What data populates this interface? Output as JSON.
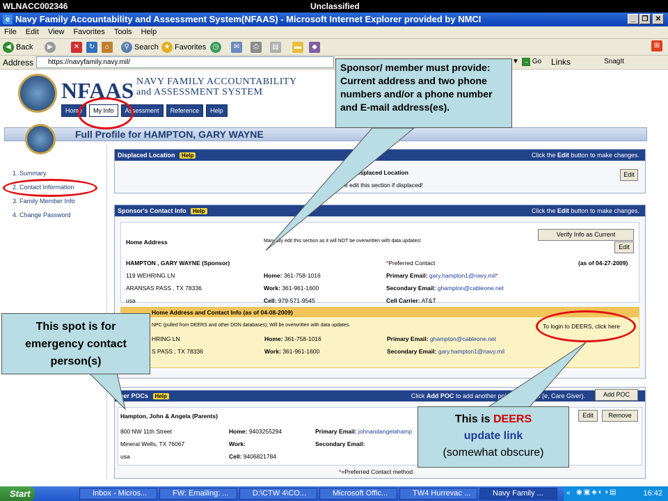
{
  "banner": {
    "left": "WLNACC002346",
    "center": "Unclassified"
  },
  "window": {
    "title": "Navy Family Accountability and Assessment System(NFAAS) - Microsoft Internet Explorer provided by NMCI"
  },
  "menu": [
    "File",
    "Edit",
    "View",
    "Favorites",
    "Tools",
    "Help"
  ],
  "toolbar": {
    "back": "Back",
    "search": "Search",
    "favorites": "Favorites"
  },
  "address": {
    "label": "Address",
    "url": "https://navyfamily.navy.mil/",
    "go": "Go",
    "links": "Links",
    "snagit": "SnagIt"
  },
  "site": {
    "brand": "NFAAS",
    "brand_sub_1": "NAVY FAMILY ACCOUNTABILITY",
    "brand_sub_2": "and ASSESSMENT SYSTEM",
    "tabs": [
      "Home",
      "My Info",
      "Assessment",
      "Reference",
      "Help"
    ],
    "profile_title": "Full Profile for HAMPTON, GARY WAYNE"
  },
  "leftnav": [
    "1. Summary",
    "2. Contact Information",
    "3. Family Member Info",
    "4. Change Password"
  ],
  "displaced": {
    "header": "Displaced Location",
    "help": "Help",
    "header_right_pre": "Click the ",
    "header_right_bold": "Edit",
    "header_right_post": " button to make changes.",
    "body_title": "Displaced Location",
    "body_note": "e edit this section if displaced!",
    "edit": "Edit"
  },
  "sponsor": {
    "header": "Sponsor's Contact Info",
    "help": "Help",
    "header_right_pre": "Click the ",
    "header_right_bold": "Edit",
    "header_right_post": " button to make changes.",
    "verify": "Verify Info as Current",
    "edit": "Edit",
    "home_address_label": "Home Address",
    "manual_note": "Manually edit this section as it will NOT be overwritten with data updates!",
    "name": "HAMPTON ,  GARY  WAYNE (Sponsor)",
    "street": "119 WEHRING LN",
    "city": "ARANSAS PASS ,  TX  78336",
    "country": "usa",
    "home_label": "Home:",
    "home": "361-758-1016",
    "work_label": "Work:",
    "work": "361-961-1600",
    "cell_label": "Cell:",
    "cell": "979-571-9545",
    "preferred": "Preferred Contact",
    "asof": "(as of 04-27-2009)",
    "primary_email_label": "Primary Email:",
    "primary_email": "gary.hampton1@navy.mil",
    "secondary_email_label": "Secondary Email:",
    "secondary_email": "ghampton@cableone.net",
    "carrier_label": "Cell Carrier:",
    "carrier": "AT&T"
  },
  "deers": {
    "header": "Home Address and Contact Info (as of 04-08-2009)",
    "sub": "NPC (pulled from DEERS and other DON databases); Will be overwritten with data updates.",
    "login": "To login to DEERS, click here",
    "street": "HRING LN",
    "city": "S PASS ,  TX  78336",
    "home_label": "Home:",
    "home": "361-758-1016",
    "work_label": "Work:",
    "work": "361-961-1600",
    "primary_email_label": "Primary Email:",
    "primary_email": "ghampton@cableone.net",
    "secondary_email_label": "Secondary Email:",
    "secondary_email": "gary.hampton1@navy.mil"
  },
  "pocs": {
    "header": "ther POCs",
    "help": "Help",
    "header_right_pre": "Click ",
    "header_right_bold": "Add POC",
    "header_right_post": " to add another point of contact (",
    "header_right_tail": "e, Care Giver).",
    "add": "Add POC",
    "edit": "Edit",
    "remove": "Remove",
    "name": "Hampton, John & Angela  (Parents)",
    "street": "800 NW 11th Street",
    "city": "Mineral Wells, TX  76067",
    "country": "usa",
    "home_label": "Home:",
    "home": "9403255294",
    "work_label": "Work:",
    "cell_label": "Cell:",
    "cell": "9406821784",
    "primary_email_label": "Primary Email:",
    "primary_email": "johnandangelahamp",
    "secondary_email_label": "Secondary Email:",
    "footnote": "=Preferred Contact method"
  },
  "callouts": {
    "sponsor": "Sponsor/ member must provide: Current address and two phone numbers and/or a phone number  and E-mail address(es).",
    "emergency": "This spot is for emergency contact person(s)",
    "deers_1": "This is ",
    "deers_2": "DEERS",
    "deers_3": "update link",
    "deers_4": "(somewhat obscure)"
  },
  "taskbar": {
    "start": "Start",
    "tasks": [
      "Inbox - Micros...",
      "FW: Emailing: ...",
      "D:\\CTW 4\\CO...",
      "Microsoft Offic...",
      "TW4 Hurrevac ...",
      "Navy Family ..."
    ],
    "clock": "16:42"
  },
  "colors": {
    "accent": "#22428a",
    "callout": "#b8dde4",
    "ring": "#e01010"
  }
}
